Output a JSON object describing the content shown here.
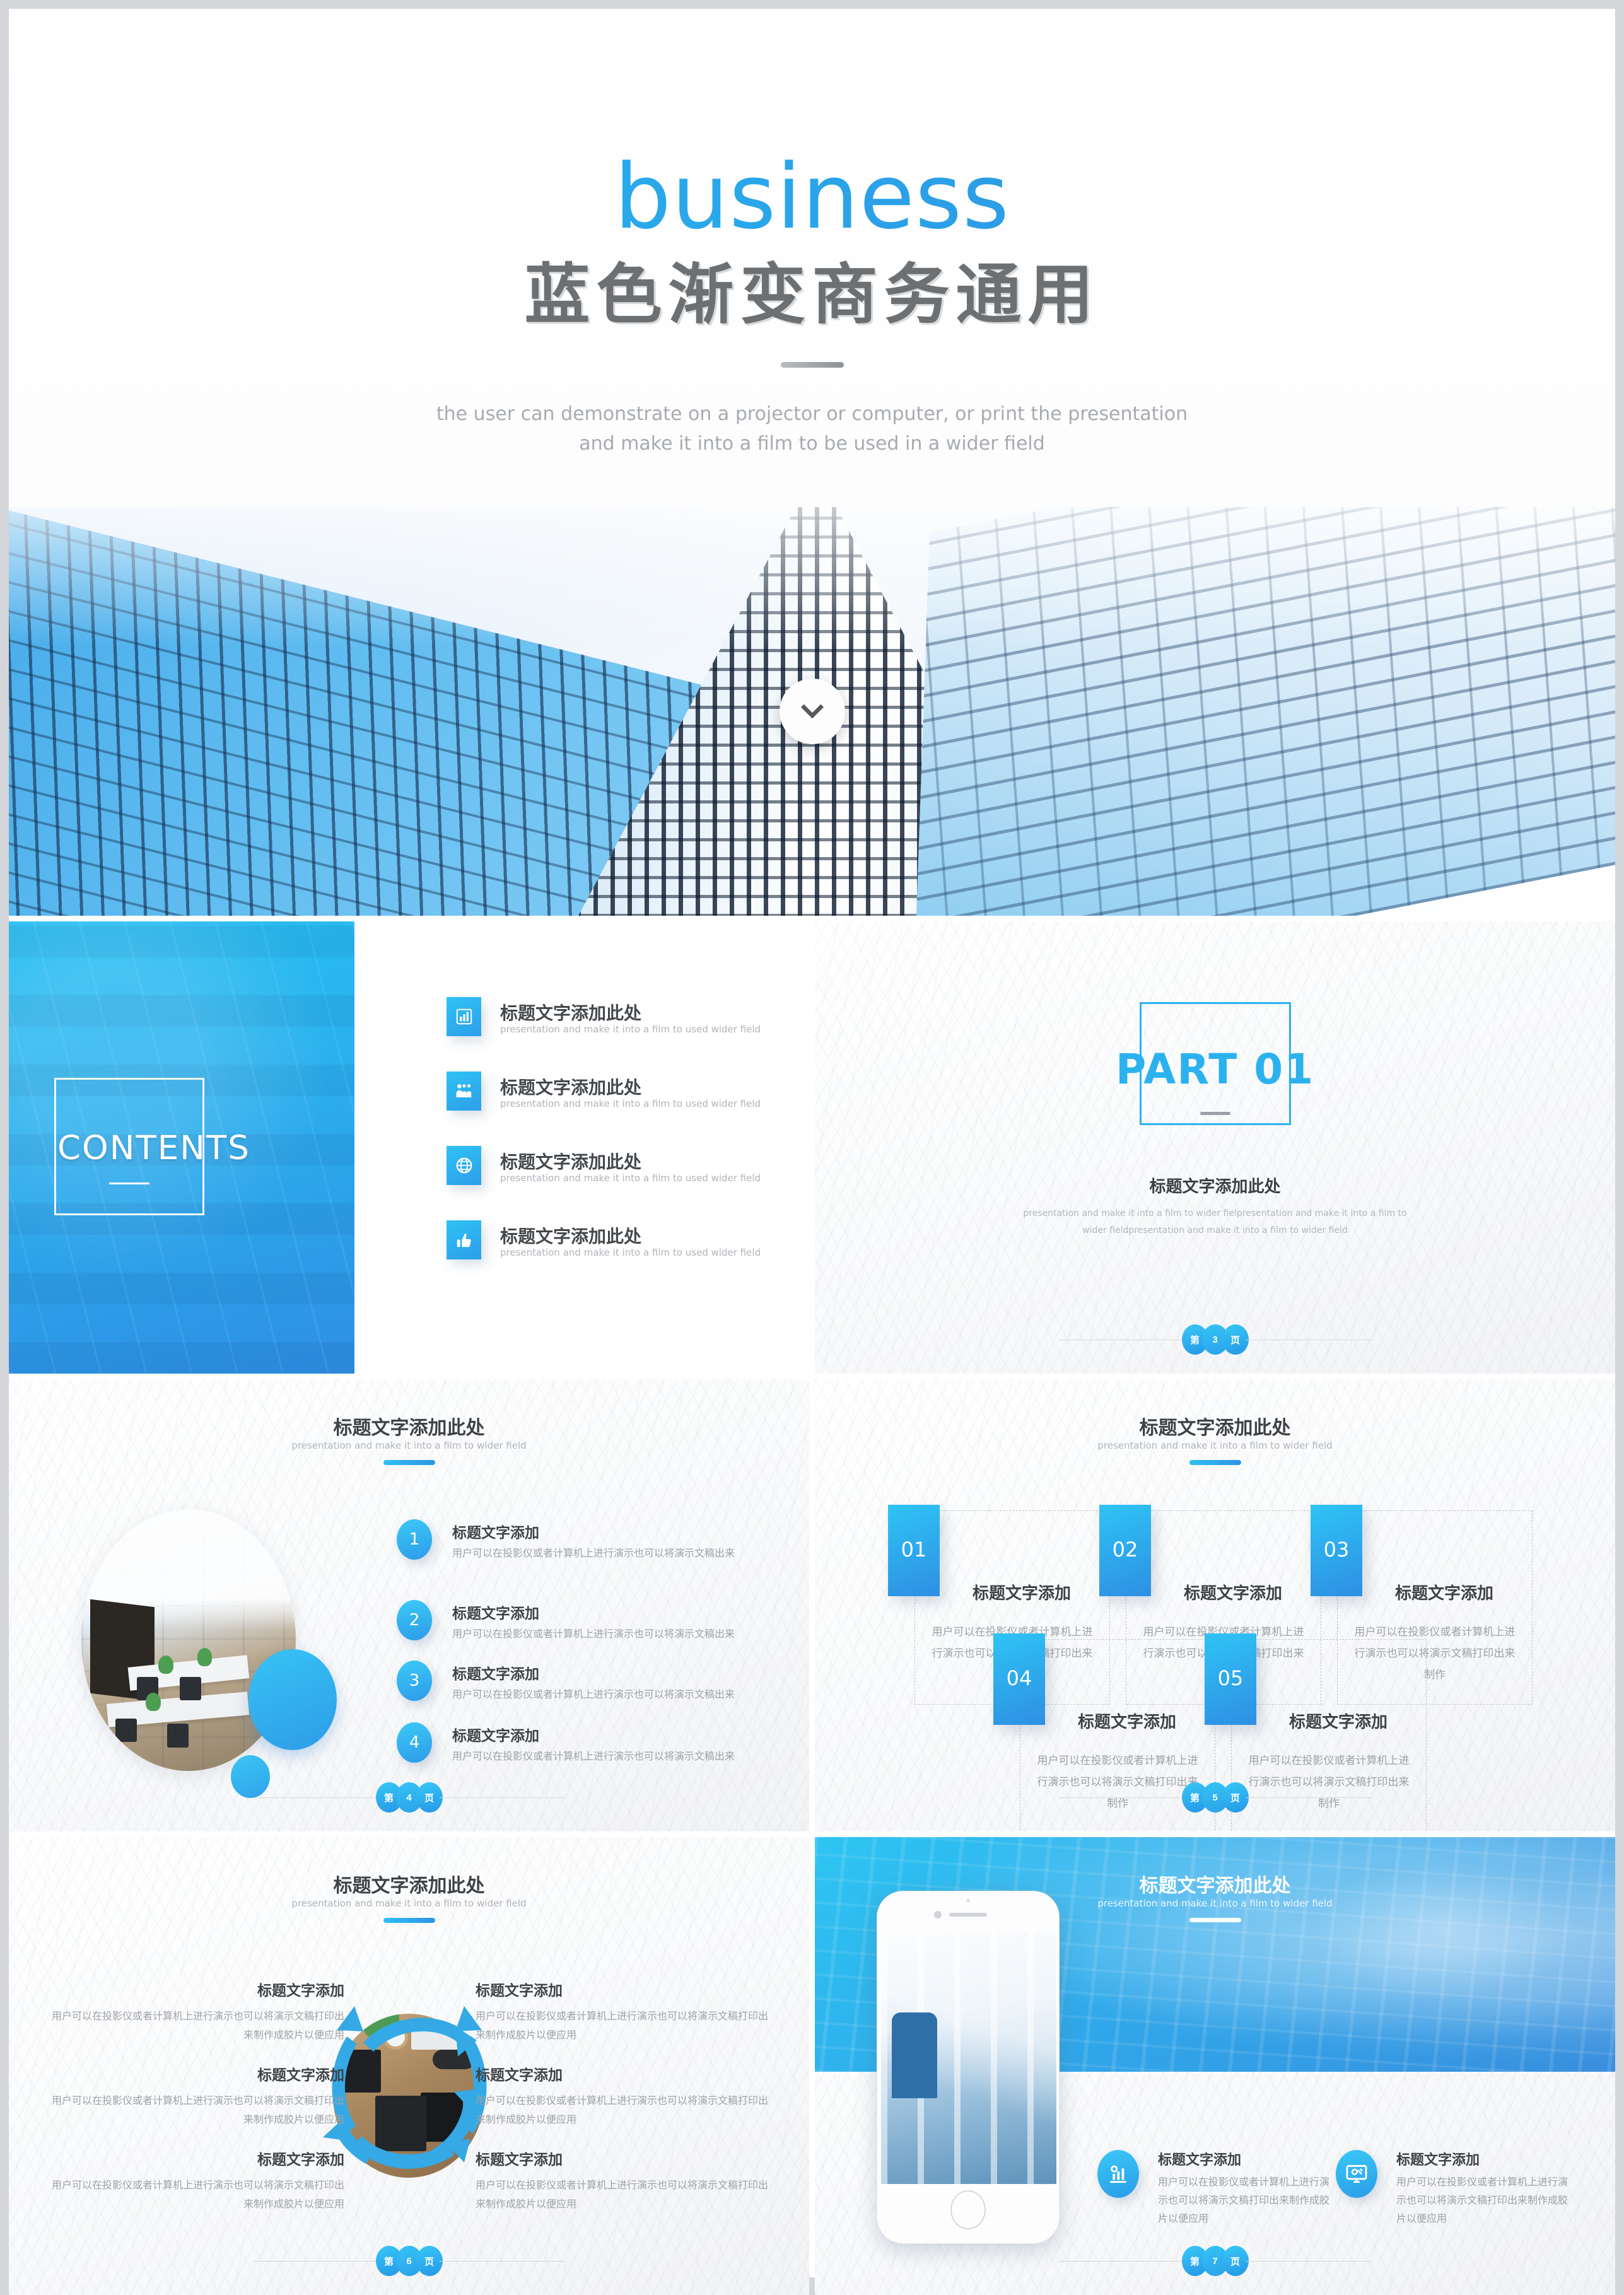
{
  "theme": {
    "accent": "#2bb2ee",
    "accent_dark": "#2e8fe3",
    "heading": "#3e4246",
    "muted": "#9da1a6"
  },
  "cover": {
    "eyebrow": "business",
    "title": "蓝色渐变商务通用",
    "subtitle_line1": "the user can demonstrate on a projector or computer, or print the presentation",
    "subtitle_line2": "and make it into a film to be used in a wider field",
    "scroll_icon": "chevron-down-icon"
  },
  "contents": {
    "label": "CONTENTS",
    "items": [
      {
        "icon": "bar-chart-icon",
        "title": "标题文字添加此处",
        "desc": "presentation and make it into a film to used wider field"
      },
      {
        "icon": "people-group-icon",
        "title": "标题文字添加此处",
        "desc": "presentation and make it into a film to used wider field"
      },
      {
        "icon": "globe-icon",
        "title": "标题文字添加此处",
        "desc": "presentation and make it into a film to used wider field"
      },
      {
        "icon": "thumbs-up-icon",
        "title": "标题文字添加此处",
        "desc": "presentation and make it into a film to used wider field"
      }
    ]
  },
  "part_slide": {
    "part_label": "PART 01",
    "title": "标题文字添加此处",
    "desc_line1": "presentation and make it into a film to wider fielpresentation and make it into a film to",
    "desc_line2": "wider fieldpresentation and make it into a film to wider field",
    "pager": {
      "prefix": "第",
      "number": "3",
      "suffix": "页"
    }
  },
  "slide4": {
    "title": "标题文字添加此处",
    "subtitle": "presentation and make it into a film to wider field",
    "items": [
      {
        "num": "1",
        "title": "标题文字添加",
        "desc": "用户可以在投影仪或者计算机上进行演示也可以将演示文稿出来"
      },
      {
        "num": "2",
        "title": "标题文字添加",
        "desc": "用户可以在投影仪或者计算机上进行演示也可以将演示文稿出来"
      },
      {
        "num": "3",
        "title": "标题文字添加",
        "desc": "用户可以在投影仪或者计算机上进行演示也可以将演示文稿出来"
      },
      {
        "num": "4",
        "title": "标题文字添加",
        "desc": "用户可以在投影仪或者计算机上进行演示也可以将演示文稿出来"
      }
    ],
    "pager": {
      "prefix": "第",
      "number": "4",
      "suffix": "页"
    }
  },
  "slide5": {
    "title": "标题文字添加此处",
    "subtitle": "presentation and make it into a film to wider field",
    "cards": [
      {
        "num": "01",
        "title": "标题文字添加",
        "desc": "用户可以在投影仪或者计算机上进行演示也可以将演示文稿打印出来制作"
      },
      {
        "num": "02",
        "title": "标题文字添加",
        "desc": "用户可以在投影仪或者计算机上进行演示也可以将演示文稿打印出来制作"
      },
      {
        "num": "03",
        "title": "标题文字添加",
        "desc": "用户可以在投影仪或者计算机上进行演示也可以将演示文稿打印出来制作"
      },
      {
        "num": "04",
        "title": "标题文字添加",
        "desc": "用户可以在投影仪或者计算机上进行演示也可以将演示文稿打印出来制作"
      },
      {
        "num": "05",
        "title": "标题文字添加",
        "desc": "用户可以在投影仪或者计算机上进行演示也可以将演示文稿打印出来制作"
      }
    ],
    "pager": {
      "prefix": "第",
      "number": "5",
      "suffix": "页"
    }
  },
  "slide6": {
    "title": "标题文字添加此处",
    "subtitle": "presentation and make it into a film to wider field",
    "items": [
      {
        "title": "标题文字添加",
        "desc": "用户可以在投影仪或者计算机上进行演示也可以将演示文稿打印出来制作成胶片以便应用"
      },
      {
        "title": "标题文字添加",
        "desc": "用户可以在投影仪或者计算机上进行演示也可以将演示文稿打印出来制作成胶片以便应用"
      },
      {
        "title": "标题文字添加",
        "desc": "用户可以在投影仪或者计算机上进行演示也可以将演示文稿打印出来制作成胶片以便应用"
      },
      {
        "title": "标题文字添加",
        "desc": "用户可以在投影仪或者计算机上进行演示也可以将演示文稿打印出来制作成胶片以便应用"
      },
      {
        "title": "标题文字添加",
        "desc": "用户可以在投影仪或者计算机上进行演示也可以将演示文稿打印出来制作成胶片以便应用"
      },
      {
        "title": "标题文字添加",
        "desc": "用户可以在投影仪或者计算机上进行演示也可以将演示文稿打印出来制作成胶片以便应用"
      }
    ],
    "pager": {
      "prefix": "第",
      "number": "6",
      "suffix": "页"
    }
  },
  "slide7": {
    "title": "标题文字添加此处",
    "subtitle": "presentation and make it into a film to wider field",
    "items": [
      {
        "icon": "chart-analytics-icon",
        "title": "标题文字添加",
        "desc": "用户可以在投影仪或者计算机上进行演示也可以将演示文稿打印出来制作成胶片以便应用"
      },
      {
        "icon": "monitor-settings-icon",
        "title": "标题文字添加",
        "desc": "用户可以在投影仪或者计算机上进行演示也可以将演示文稿打印出来制作成胶片以便应用"
      }
    ],
    "pager": {
      "prefix": "第",
      "number": "7",
      "suffix": "页"
    }
  }
}
